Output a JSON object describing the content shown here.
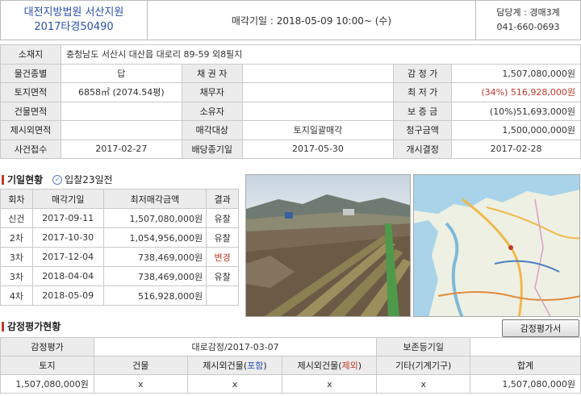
{
  "header": {
    "court": "대전지방법원 서산지원",
    "case_no": "2017타경50490",
    "sale_date_label": "매각기일 : 2018-05-09   10:00~ (수)",
    "dept": "담당계 : 경매3계",
    "phone": "041-660-0693"
  },
  "info": {
    "location_label": "소재지",
    "location_value": "충청남도 서산시 대산읍 대로리 89-59 외8필지",
    "type_label": "물건종별",
    "type_value": "답",
    "creditor_label": "채 권 자",
    "creditor_value": "",
    "appraisal_label": "감 정 가",
    "appraisal_value": "1,507,080,000원",
    "land_label": "토지면적",
    "land_value": "6858㎡ (2074.54평)",
    "debtor_label": "채무자",
    "debtor_value": "",
    "min_label": "최 저 가",
    "min_value": "(34%) 516,928,000원",
    "bldg_label": "건물면적",
    "bldg_value": "",
    "owner_label": "소유자",
    "owner_value": "",
    "deposit_label": "보 증 금",
    "deposit_value": "(10%)51,693,000원",
    "excl_label": "제시외면적",
    "excl_value": "",
    "target_label": "매각대상",
    "target_value": "토지일괄매각",
    "claim_label": "청구금액",
    "claim_value": "1,500,000,000원",
    "case_received_label": "사건접수",
    "case_received_value": "2017-02-27",
    "dividend_label": "배당종기일",
    "dividend_value": "2017-05-30",
    "commence_label": "개시결정",
    "commence_value": "2017-02-28"
  },
  "auction_section": {
    "title": "기일현황",
    "bid_note": "입찰23일전",
    "headers": [
      "회차",
      "매각기일",
      "최저매각금액",
      "결과"
    ],
    "rows": [
      {
        "round": "신건",
        "date": "2017-09-11",
        "price": "1,507,080,000원",
        "result": "유찰"
      },
      {
        "round": "2차",
        "date": "2017-10-30",
        "price": "1,054,956,000원",
        "result": "유찰"
      },
      {
        "round": "3차",
        "date": "2017-12-04",
        "price": "738,469,000원",
        "result": "변경"
      },
      {
        "round": "3차",
        "date": "2018-04-04",
        "price": "738,469,000원",
        "result": "유찰"
      },
      {
        "round": "4차",
        "date": "2018-05-09",
        "price": "516,928,000원",
        "result": ""
      }
    ]
  },
  "appraisal_section": {
    "title": "감정평가현황",
    "button": "감정평가서",
    "row1": {
      "label": "감정평가",
      "value": "대로감정/2017-03-07",
      "label2": "보존등기일",
      "value2": ""
    },
    "headers": [
      "토지",
      "건물",
      "제시외건물(",
      "포함",
      ")",
      "제시외건물(",
      "제외",
      ")",
      "기타(기계기구)",
      "합계"
    ],
    "values": [
      "1,507,080,000원",
      "x",
      "x",
      "x",
      "x",
      "1,507,080,000원"
    ]
  },
  "colors": {
    "accent_red": "#c0392b",
    "court_blue": "#2a4fb0",
    "label_bg": "#ececec"
  }
}
